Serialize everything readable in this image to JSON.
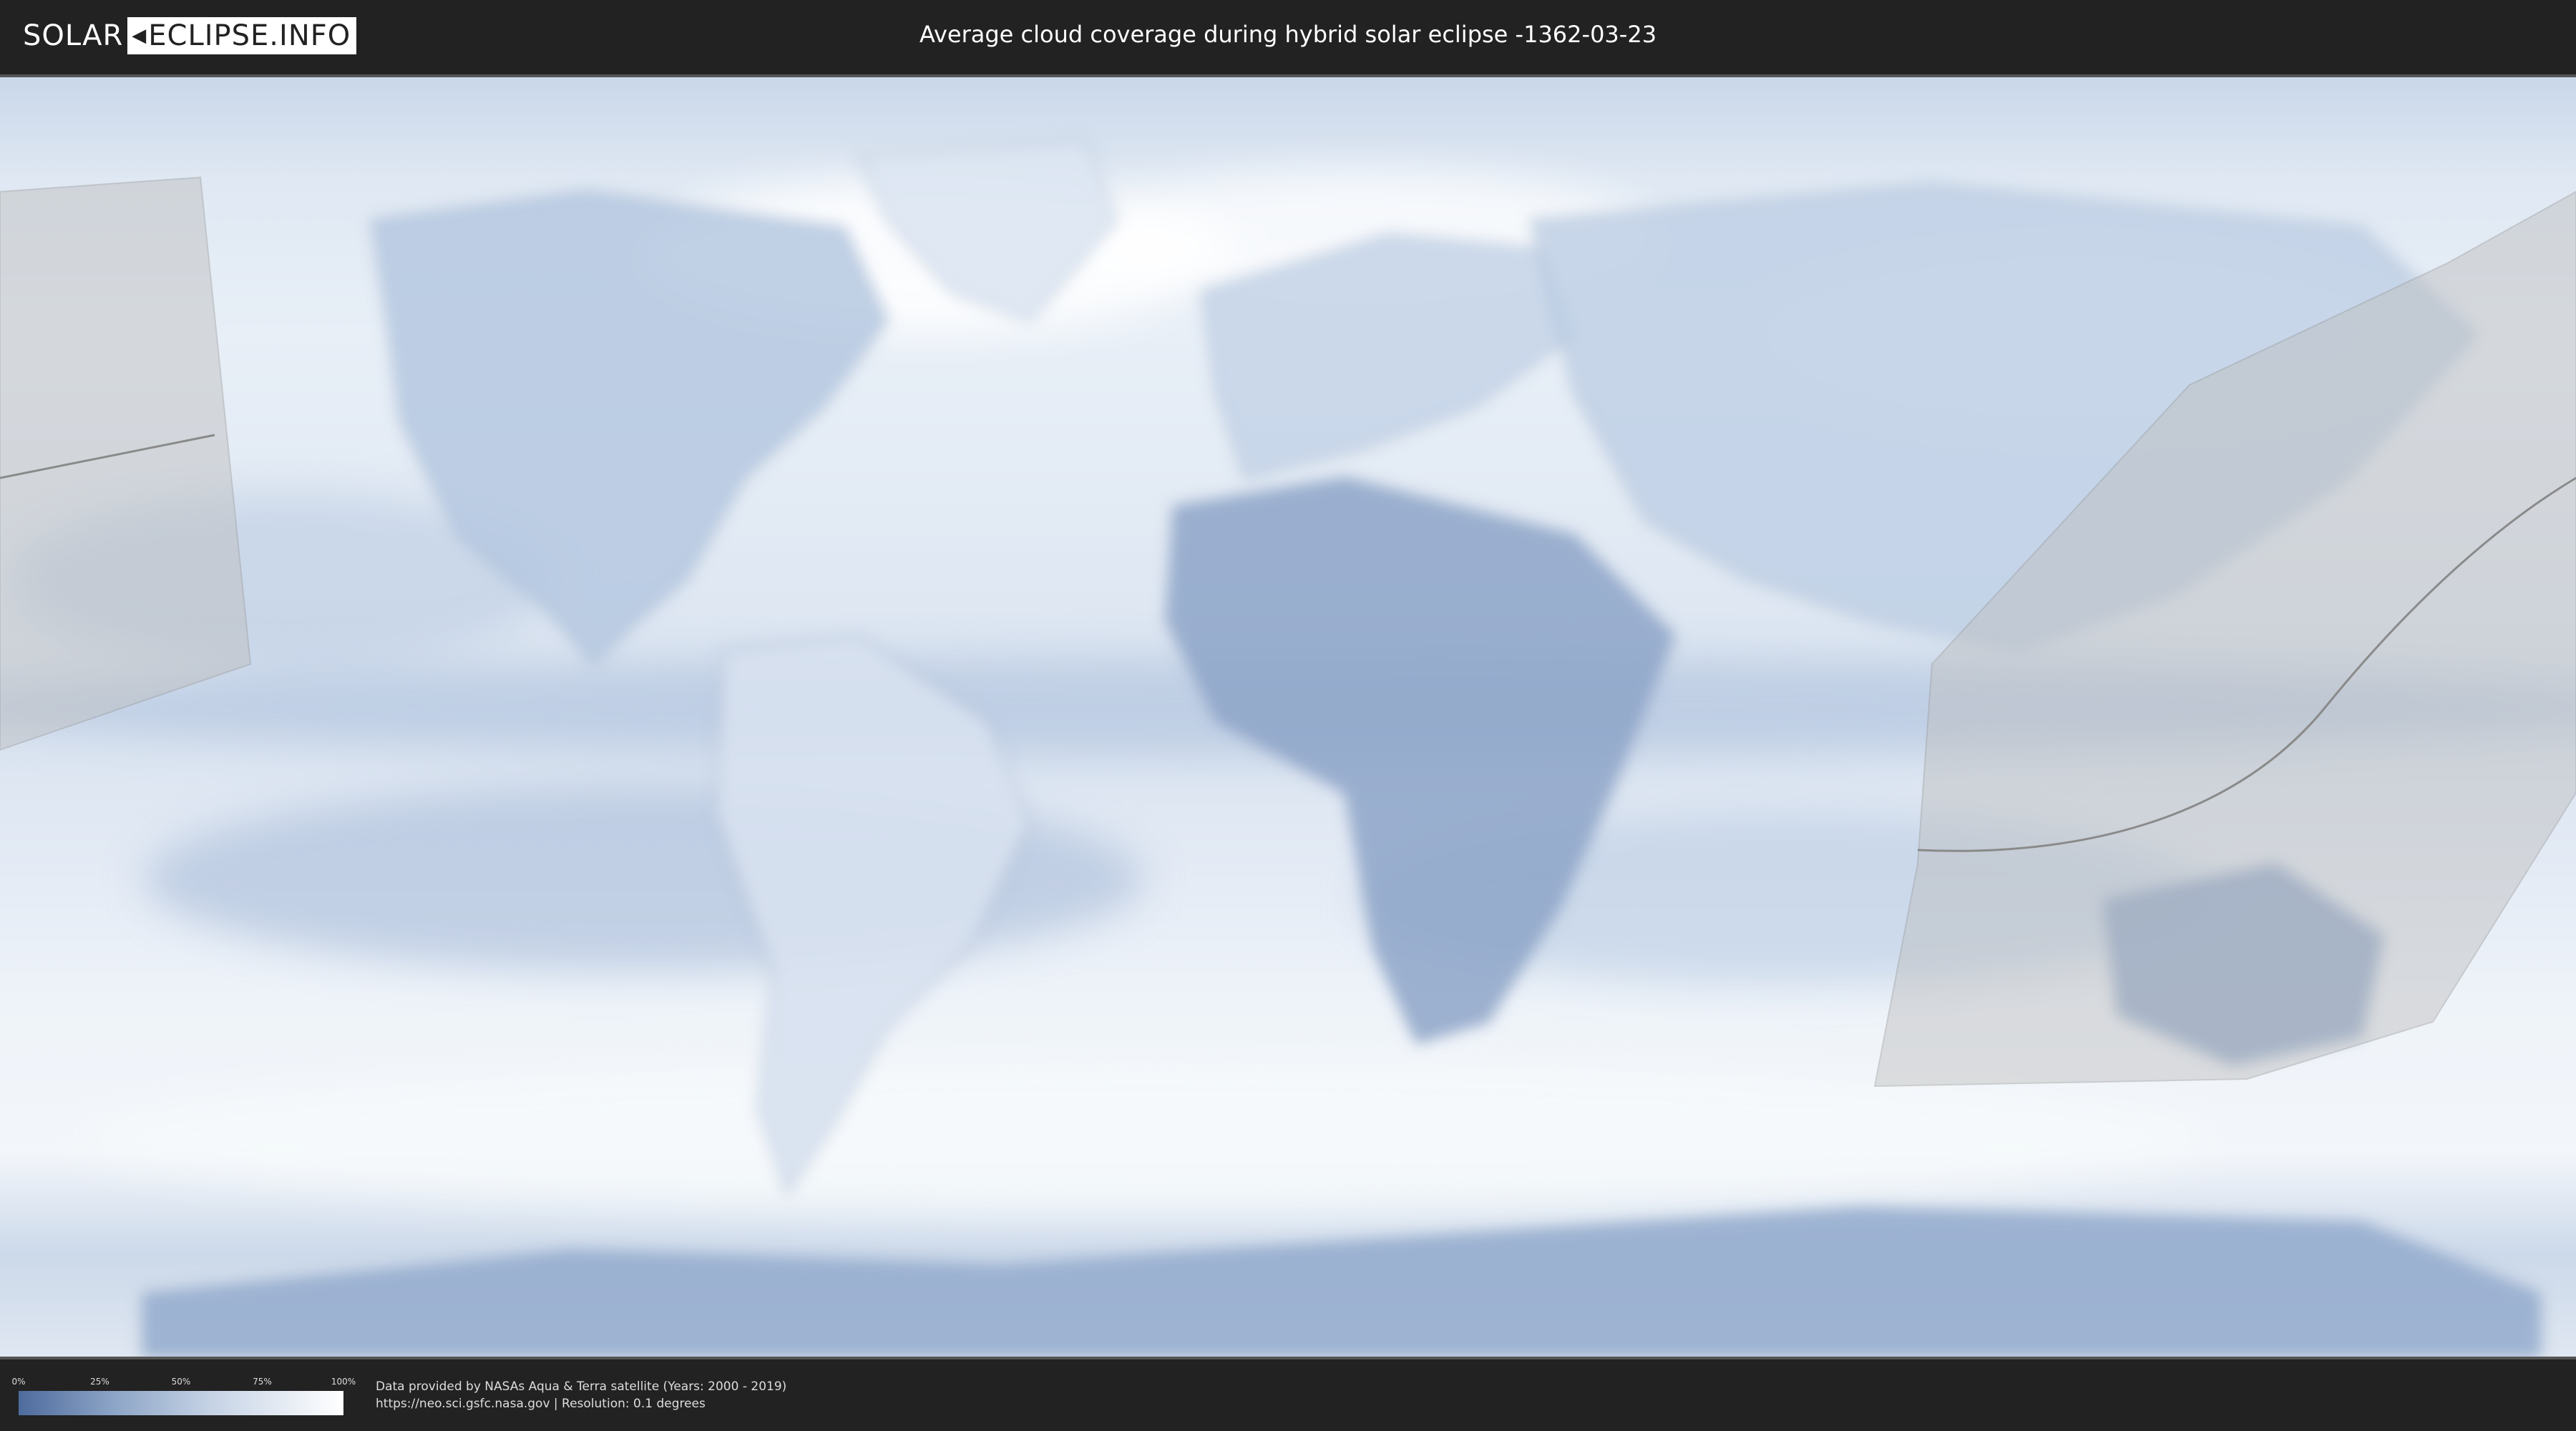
{
  "header": {
    "logo": {
      "left": "SOLAR",
      "right": "ECLIPSE.INFO"
    },
    "title": "Average cloud coverage during hybrid solar eclipse -1362-03-23"
  },
  "map": {
    "type": "world cloud coverage map",
    "colors": {
      "clear": "#4e6b9e",
      "cloudy": "#ffffff",
      "eclipse_visibility_overlay": "#bfbfbf"
    }
  },
  "legend": {
    "ticks": [
      "0%",
      "25%",
      "50%",
      "75%",
      "100%"
    ],
    "gradient_start": "#4e6b9e",
    "gradient_end": "#ffffff"
  },
  "footer": {
    "credit_line1": "Data provided by NASAs Aqua & Terra satellite (Years: 2000 - 2019)",
    "credit_line2": "https://neo.sci.gsfc.nasa.gov | Resolution: 0.1 degrees"
  }
}
